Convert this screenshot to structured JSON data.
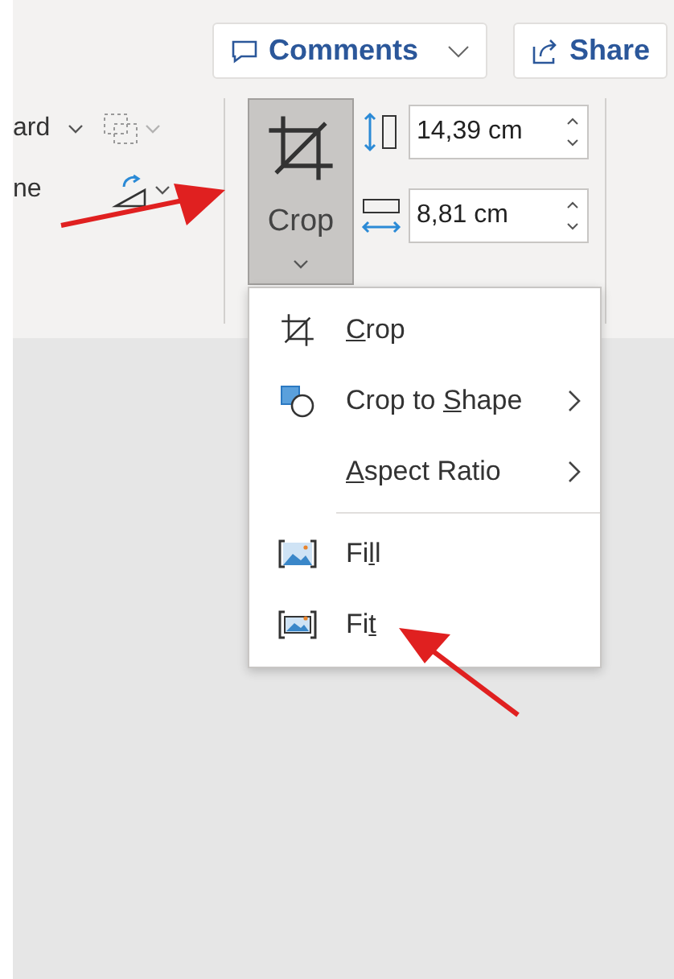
{
  "header_buttons": [
    {
      "kind": "comments",
      "label": "Comments",
      "has_dropdown": true
    },
    {
      "kind": "share",
      "label": "Share"
    }
  ],
  "ribbon_left": [
    {
      "label": "ard",
      "kind": "group"
    },
    {
      "label": "ne",
      "kind": "rotate"
    }
  ],
  "crop_button": {
    "label": "Crop",
    "pressed": true
  },
  "size_fields": [
    {
      "kind": "height",
      "value": "14,39 cm"
    },
    {
      "kind": "width",
      "value": "8,81 cm"
    }
  ],
  "crop_menu": [
    {
      "kind": "crop",
      "key": "C",
      "after": "rop",
      "submenu": false
    },
    {
      "kind": "shape",
      "before": "Crop to ",
      "key": "S",
      "after": "hape",
      "submenu": true
    },
    {
      "kind": "none",
      "key": "A",
      "after": "spect Ratio",
      "submenu": true
    },
    {
      "kind": "divider"
    },
    {
      "kind": "fill",
      "before": "Fi",
      "key": "l",
      "after": "l",
      "submenu": false
    },
    {
      "kind": "fit",
      "before": "Fi",
      "key": "t",
      "submenu": false
    }
  ]
}
